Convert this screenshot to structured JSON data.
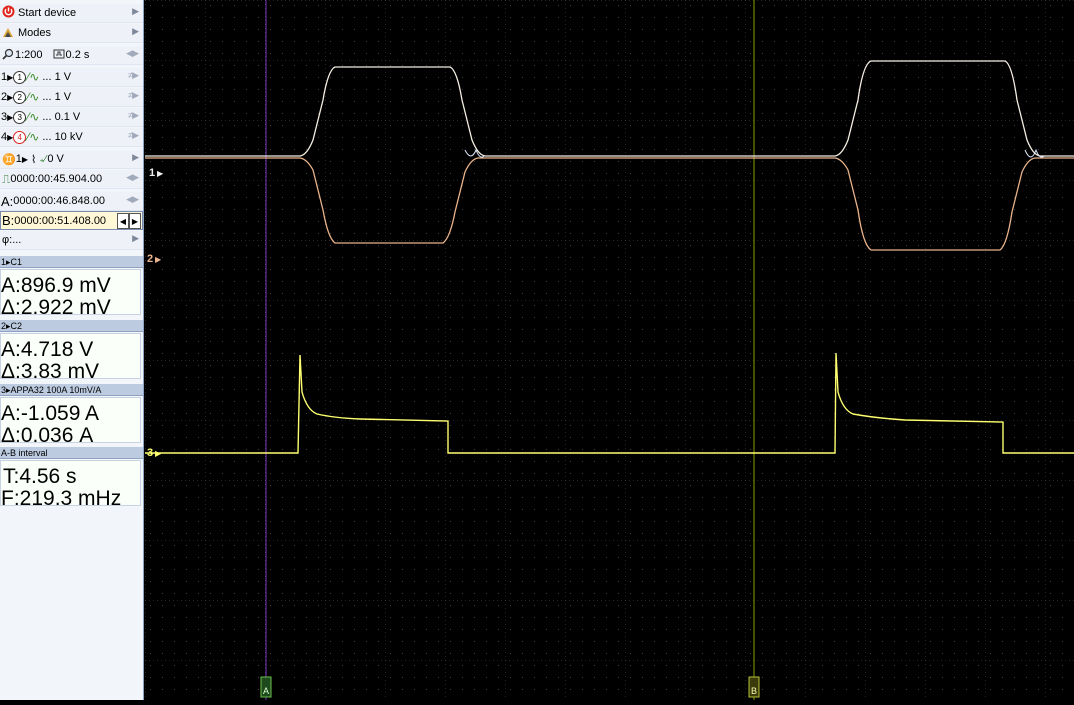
{
  "toolbar": {
    "start_device": "Start device",
    "modes": "Modes",
    "scale": "1:200",
    "timebase": "0.2 s"
  },
  "channels": [
    {
      "num": "1",
      "badge": "1",
      "value": "... 1 V"
    },
    {
      "num": "2",
      "badge": "2",
      "value": "... 1 V"
    },
    {
      "num": "3",
      "badge": "3",
      "value": "... 0.1 V"
    },
    {
      "num": "4",
      "badge": "4",
      "value": "... 10 kV"
    }
  ],
  "trigger": {
    "channel": "1",
    "level": "0 V"
  },
  "times": {
    "current": "0000:00:45.904.00",
    "a_prefix": "A:",
    "a": "0000:00:46.848.00",
    "b_prefix": "B:",
    "b": "0000:00:51.408.00",
    "phi": "φ:..."
  },
  "measurements": [
    {
      "header": "1▸C1",
      "a": "A:896.9 mV",
      "delta": "Δ:2.922 mV"
    },
    {
      "header": "2▸C2",
      "a": "A:4.718 V",
      "delta": "Δ:3.83 mV"
    },
    {
      "header": "3▸APPA32 100A 10mV/A",
      "a": "A:-1.059 A",
      "delta": "Δ:0.036 A"
    },
    {
      "header": "A-B interval",
      "a": "T:4.56 s",
      "delta": "F:219.3 mHz"
    }
  ],
  "scope": {
    "ch1_marker": "1",
    "ch2_marker": "2",
    "ch3_marker": "3",
    "cursor_a": "A",
    "cursor_b": "B",
    "colors": {
      "ch1": "#f4eee2",
      "ch2": "#eab48c",
      "ch3": "#ffff70",
      "cursor_a": "#7c35c0",
      "cursor_b": "#88a000"
    }
  }
}
